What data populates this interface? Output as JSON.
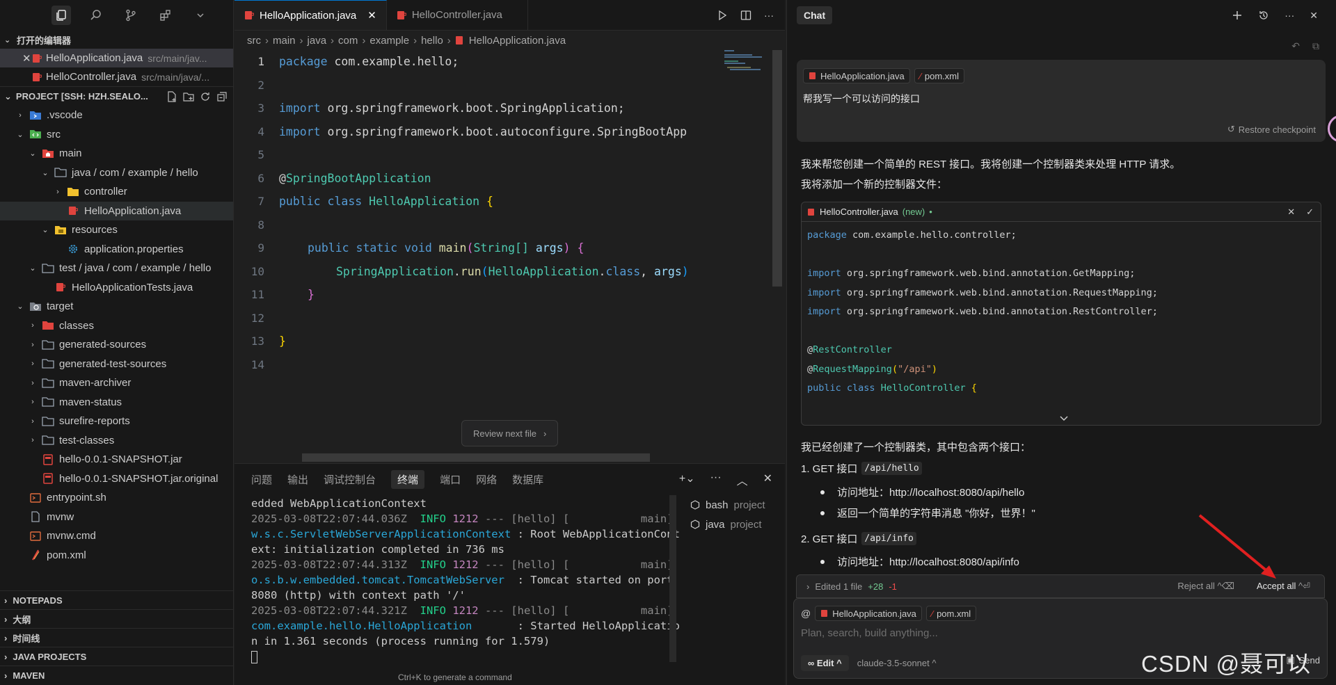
{
  "sidebar": {
    "open_editors_title": "打开的编辑器",
    "open_editors": [
      {
        "name": "HelloApplication.java",
        "path": "src/main/jav..."
      },
      {
        "name": "HelloController.java",
        "path": "src/main/java/..."
      }
    ],
    "project_title": "PROJECT [SSH: HZH.SEALO...",
    "tree": [
      {
        "label": ".vscode"
      },
      {
        "label": "src"
      },
      {
        "label": "main"
      },
      {
        "label": "java / com / example / hello"
      },
      {
        "label": "controller"
      },
      {
        "label": "HelloApplication.java"
      },
      {
        "label": "resources"
      },
      {
        "label": "application.properties"
      },
      {
        "label": "test / java / com / example / hello"
      },
      {
        "label": "HelloApplicationTests.java"
      },
      {
        "label": "target"
      },
      {
        "label": "classes"
      },
      {
        "label": "generated-sources"
      },
      {
        "label": "generated-test-sources"
      },
      {
        "label": "maven-archiver"
      },
      {
        "label": "maven-status"
      },
      {
        "label": "surefire-reports"
      },
      {
        "label": "test-classes"
      },
      {
        "label": "hello-0.0.1-SNAPSHOT.jar"
      },
      {
        "label": "hello-0.0.1-SNAPSHOT.jar.original"
      },
      {
        "label": "entrypoint.sh"
      },
      {
        "label": "mvnw"
      },
      {
        "label": "mvnw.cmd"
      },
      {
        "label": "pom.xml"
      }
    ],
    "bottom_sections": [
      "NOTEPADS",
      "大纲",
      "时间线",
      "JAVA PROJECTS",
      "MAVEN"
    ]
  },
  "editor": {
    "tabs": [
      "HelloApplication.java",
      "HelloController.java"
    ],
    "breadcrumb": [
      "src",
      "main",
      "java",
      "com",
      "example",
      "hello",
      "HelloApplication.java"
    ],
    "line_numbers": [
      "1",
      "2",
      "3",
      "4",
      "5",
      "6",
      "7",
      "8",
      "9",
      "10",
      "11",
      "12",
      "13",
      "14"
    ],
    "code": {
      "l1_kw": "package",
      "l1_rest": " com.example.hello;",
      "l3_kw": "import",
      "l3_rest": " org.springframework.boot.SpringApplication;",
      "l4_kw": "import",
      "l4_rest": " org.springframework.boot.autoconfigure.SpringBootApp",
      "l6_at": "@",
      "l6_ann": "SpringBootApplication",
      "l7_kw": "public class",
      "l7_cls": "HelloApplication",
      "l7_br": "{",
      "l9_kw": "public static void",
      "l9_fn": "main",
      "l9_p1": "(",
      "l9_ty": "String[]",
      "l9_va": "args",
      "l9_p2": ")",
      "l9_br": "{",
      "l10_cls": "SpringApplication",
      "l10_dot": ".",
      "l10_fn": "run",
      "l10_p1": "(",
      "l10_cls2": "HelloApplication",
      "l10_dot2": ".",
      "l10_kw": "class",
      "l10_comma": ", ",
      "l10_va": "args",
      "l10_p2": ")",
      "l11_br": "}",
      "l13_br": "}"
    },
    "review_button": "Review next file"
  },
  "panel": {
    "tabs": [
      "问题",
      "输出",
      "调试控制台",
      "终端",
      "端口",
      "网络",
      "数据库"
    ],
    "active_tab": "终端",
    "terminal": {
      "l1": "edded WebApplicationContext",
      "l2_ts": "2025-03-08T22:07:44.036Z",
      "l2_lvl": "INFO",
      "l2_pid": "1212",
      "l2_mid": " --- [hello] [           main]",
      "l3_cls": "w.s.c.ServletWebServerApplicationContext",
      "l3_rest": " : Root WebApplicationCont",
      "l4": "ext: initialization completed in 736 ms",
      "l5_ts": "2025-03-08T22:07:44.313Z",
      "l5_lvl": "INFO",
      "l5_pid": "1212",
      "l5_mid": " --- [hello] [           main]",
      "l6_cls": "o.s.b.w.embedded.tomcat.TomcatWebServer",
      "l6_rest": "  : Tomcat started on port",
      "l7": "8080 (http) with context path '/'",
      "l8_ts": "2025-03-08T22:07:44.321Z",
      "l8_lvl": "INFO",
      "l8_pid": "1212",
      "l8_mid": " --- [hello] [           main]",
      "l9_cls": "com.example.hello.HelloApplication",
      "l9_rest": "       : Started HelloApplicatio",
      "l10": "n in 1.361 seconds (process running for 1.579)"
    },
    "terminals": [
      {
        "shell": "bash",
        "name": "project"
      },
      {
        "shell": "java",
        "name": "project"
      }
    ],
    "hint": "Ctrl+K to generate a command"
  },
  "chat": {
    "title": "Chat",
    "user_message": {
      "pills": [
        "HelloApplication.java",
        "pom.xml"
      ],
      "text": "帮我写一个可以访问的接口",
      "restore": "Restore checkpoint"
    },
    "intro1": "我来帮您创建一个简单的 REST 接口。我将创建一个控制器类来处理 HTTP 请求。",
    "intro2": "我将添加一个新的控制器文件：",
    "card": {
      "filename": "HelloController.java",
      "badge": "(new)",
      "dot": "•",
      "c1_kw": "package",
      "c1_rest": " com.example.hello.controller;",
      "c3_kw": "import",
      "c3_rest": " org.springframework.web.bind.annotation.GetMapping;",
      "c4_kw": "import",
      "c4_rest": " org.springframework.web.bind.annotation.RequestMapping;",
      "c5_kw": "import",
      "c5_rest": " org.springframework.web.bind.annotation.RestController;",
      "c7_at": "@",
      "c7_ann": "RestController",
      "c8_at": "@",
      "c8_ann": "RequestMapping",
      "c8_p1": "(",
      "c8_str": "\"/api\"",
      "c8_p2": ")",
      "c9_kw": "public class",
      "c9_cls": "HelloController",
      "c9_br": "{"
    },
    "summary": "我已经创建了一个控制器类，其中包含两个接口：",
    "items": [
      {
        "label": "1. GET 接口",
        "code": "/api/hello"
      },
      {
        "label": "2. GET 接口",
        "code": "/api/info"
      }
    ],
    "bullets": [
      "访问地址：http://localhost:8080/api/hello",
      "返回一个简单的字符串消息 \"你好，世界！\"",
      "访问地址：http://localhost:8080/api/info"
    ],
    "edit_bar": {
      "label": "Edited 1 file",
      "added": "+28",
      "removed": "-1",
      "reject": "Reject all",
      "reject_key": "^⌫",
      "accept": "Accept all",
      "accept_key": "^⏎"
    },
    "composer": {
      "at": "@",
      "pills": [
        "HelloApplication.java",
        "pom.xml"
      ],
      "placeholder": "Plan, search, build anything...",
      "mode": "Edit",
      "model": "claude-3.5-sonnet",
      "send": "Send"
    }
  },
  "watermark": "CSDN @聂可以",
  "colors": {
    "accent": "#0078d4",
    "java_icon": "#e0443e",
    "arrow": "#e02020"
  }
}
